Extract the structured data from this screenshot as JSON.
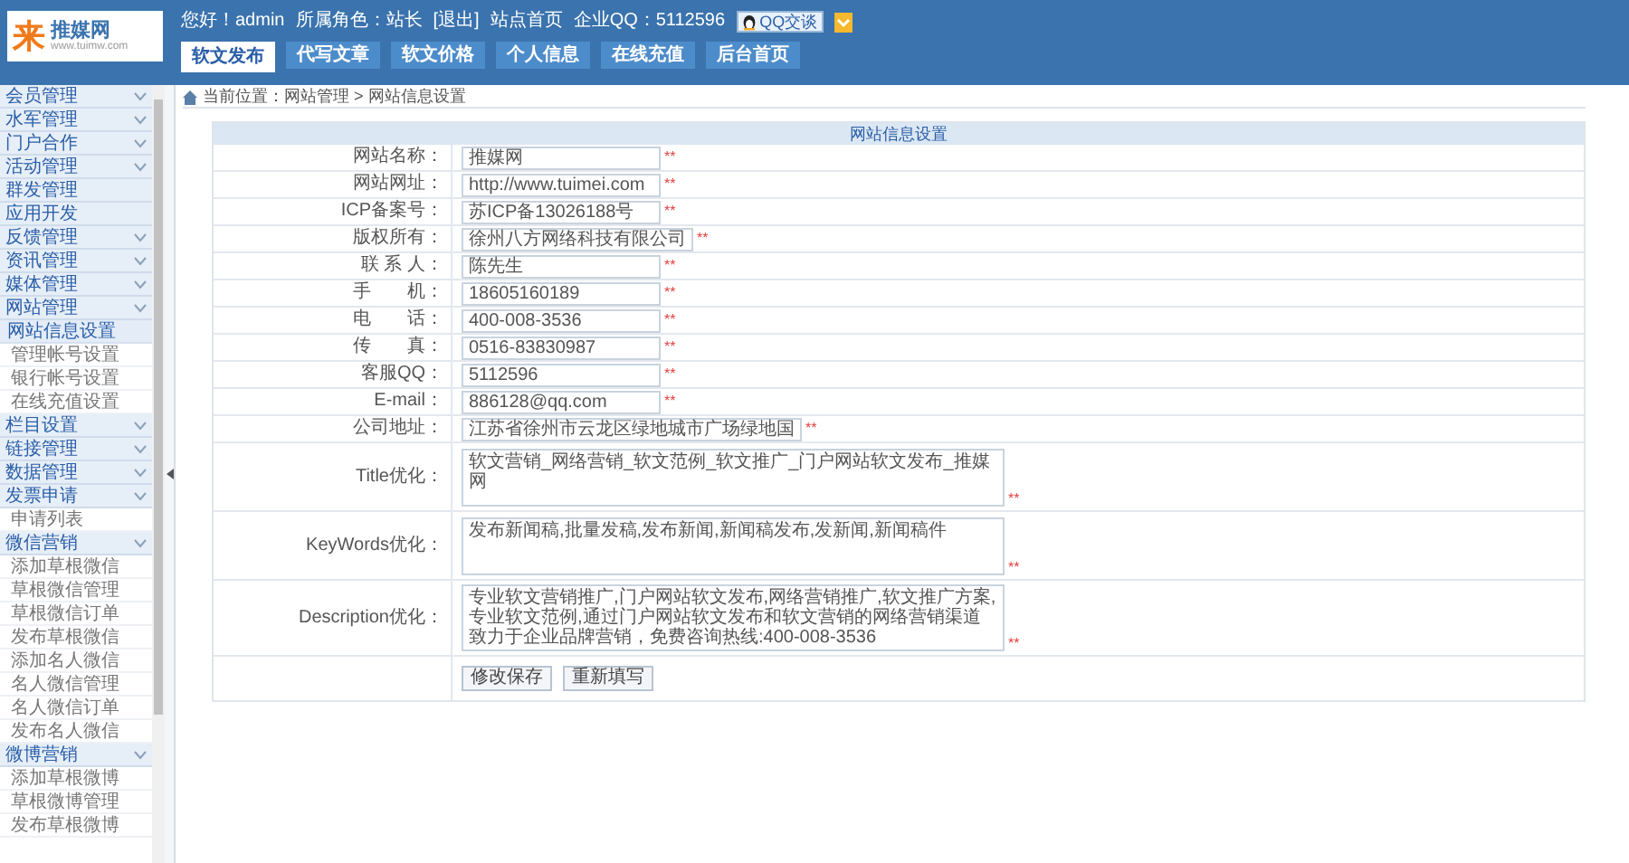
{
  "header": {
    "logo_mark": "来",
    "logo_name": "推媒网",
    "logo_url": "www.tuimw.com",
    "links": [
      "您好！admin",
      "所属角色：站长",
      "[退出]",
      "站点首页",
      "企业QQ：5112596"
    ],
    "qq_button": "QQ交谈"
  },
  "tabs": [
    {
      "label": "软文发布",
      "selected": true
    },
    {
      "label": "代写文章",
      "selected": false
    },
    {
      "label": "软文价格",
      "selected": false
    },
    {
      "label": "个人信息",
      "selected": false
    },
    {
      "label": "在线充值",
      "selected": false
    },
    {
      "label": "后台首页",
      "selected": false
    }
  ],
  "sidebar": {
    "items": [
      {
        "label": "会员管理",
        "expandable": true
      },
      {
        "label": "水军管理",
        "expandable": true
      },
      {
        "label": "门户合作",
        "expandable": true
      },
      {
        "label": "活动管理",
        "expandable": true
      },
      {
        "label": "群发管理",
        "expandable": false
      },
      {
        "label": "应用开发",
        "expandable": false
      },
      {
        "label": "反馈管理",
        "expandable": true
      },
      {
        "label": "资讯管理",
        "expandable": true
      },
      {
        "label": "媒体管理",
        "expandable": true
      },
      {
        "label": "网站管理",
        "expandable": true,
        "children": [
          {
            "label": "网站信息设置",
            "selected": true
          },
          {
            "label": "管理帐号设置",
            "selected": false
          },
          {
            "label": "银行帐号设置",
            "selected": false
          },
          {
            "label": "在线充值设置",
            "selected": false
          }
        ]
      },
      {
        "label": "栏目设置",
        "expandable": true
      },
      {
        "label": "链接管理",
        "expandable": true
      },
      {
        "label": "数据管理",
        "expandable": true
      },
      {
        "label": "发票申请",
        "expandable": true,
        "children": [
          {
            "label": "申请列表",
            "selected": false
          }
        ]
      },
      {
        "label": "微信营销",
        "expandable": true,
        "children": [
          {
            "label": "添加草根微信",
            "selected": false
          },
          {
            "label": "草根微信管理",
            "selected": false
          },
          {
            "label": "草根微信订单",
            "selected": false
          },
          {
            "label": "发布草根微信",
            "selected": false
          },
          {
            "label": "添加名人微信",
            "selected": false
          },
          {
            "label": "名人微信管理",
            "selected": false
          },
          {
            "label": "名人微信订单",
            "selected": false
          },
          {
            "label": "发布名人微信",
            "selected": false
          }
        ]
      },
      {
        "label": "微博营销",
        "expandable": true,
        "children": [
          {
            "label": "添加草根微博",
            "selected": false
          },
          {
            "label": "草根微博管理",
            "selected": false
          },
          {
            "label": "发布草根微博",
            "selected": false
          }
        ]
      }
    ]
  },
  "breadcrumb": "当前位置：网站管理 > 网站信息设置",
  "form": {
    "title": "网站信息设置",
    "fields": [
      {
        "kind": "input",
        "label": "网站名称：",
        "value": "推媒网",
        "required_mark": "**"
      },
      {
        "kind": "input",
        "label": "网站网址：",
        "value": "http://www.tuimei.com",
        "required_mark": "**"
      },
      {
        "kind": "input",
        "label": "ICP备案号：",
        "value": "苏ICP备13026188号",
        "required_mark": "**"
      },
      {
        "kind": "input",
        "label": "版权所有：",
        "value": "徐州八方网络科技有限公司",
        "required_mark": "**"
      },
      {
        "kind": "input",
        "label": "联 系 人：",
        "value": "陈先生",
        "required_mark": "**"
      },
      {
        "kind": "input",
        "label": "手　　机：",
        "value": "18605160189",
        "required_mark": "**"
      },
      {
        "kind": "input",
        "label": "电　　话：",
        "value": "400-008-3536",
        "required_mark": "**"
      },
      {
        "kind": "input",
        "label": "传　　真：",
        "value": "0516-83830987",
        "required_mark": "**"
      },
      {
        "kind": "input",
        "label": "客服QQ：",
        "value": "5112596",
        "required_mark": "**"
      },
      {
        "kind": "input",
        "label": "E-mail：",
        "value": "886128@qq.com",
        "required_mark": "**"
      },
      {
        "kind": "input",
        "label": "公司地址：",
        "value": "江苏省徐州市云龙区绿地城市广场绿地国",
        "required_mark": "**"
      },
      {
        "kind": "textarea",
        "label": "Title优化：",
        "value": "软文营销_网络营销_软文范例_软文推广_门户网站软文发布_推媒网",
        "required_mark": "**"
      },
      {
        "kind": "textarea",
        "label": "KeyWords优化：",
        "value": "发布新闻稿,批量发稿,发布新闻,新闻稿发布,发新闻,新闻稿件",
        "required_mark": "**"
      },
      {
        "kind": "textarea",
        "label": "Description优化：",
        "value": "专业软文营销推广,门户网站软文发布,网络营销推广,软文推广方案,专业软文范例,通过门户网站软文发布和软文营销的网络营销渠道致力于企业品牌营销，免费咨询热线:400-008-3536",
        "required_mark": "**"
      }
    ],
    "buttons": [
      "修改保存",
      "重新填写"
    ]
  }
}
